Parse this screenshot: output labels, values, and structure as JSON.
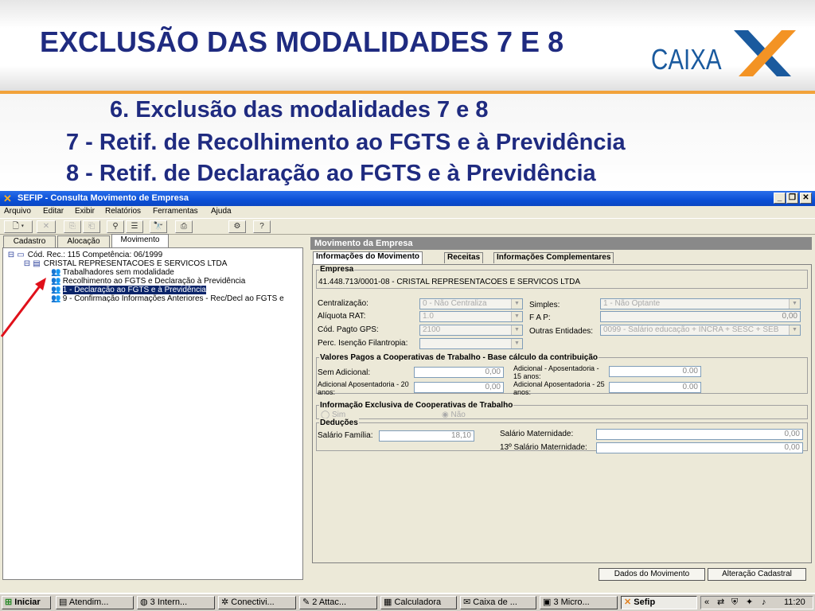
{
  "slide": {
    "title": "EXCLUSÃO DAS MODALIDADES 7 E 8",
    "logo_text": "CAIXA",
    "line1": "6. Exclusão das modalidades 7 e 8",
    "line2": "7 - Retif. de Recolhimento ao FGTS e à Previdência",
    "line3": "8 - Retif. de Declaração ao FGTS e à Previdência"
  },
  "window": {
    "title": "SEFIP - Consulta Movimento de Empresa",
    "menu": [
      "Arquivo",
      "Editar",
      "Exibir",
      "Relatórios",
      "Ferramentas",
      "Ajuda"
    ],
    "left_tabs": [
      "Cadastro",
      "Alocação",
      "Movimento"
    ],
    "tree": [
      "Cód. Rec.: 115 Competência: 06/1999",
      "CRISTAL REPRESENTACOES E SERVICOS LTDA",
      "Trabalhadores sem modalidade",
      "Recolhimento ao FGTS e Declaração à Previdência",
      "1 - Declaração ao FGTS e à Previdência",
      "9 - Confirmação Informações Anteriores - Rec/Decl ao FGTS e"
    ],
    "pane_title": "Movimento da Empresa",
    "right_tabs": [
      "Informações do Movimento",
      "Receitas",
      "Informações Complementares"
    ],
    "empresa_group": "Empresa",
    "empresa_value": "41.448.713/0001-08 - CRISTAL REPRESENTACOES E SERVICOS LTDA",
    "centralizacao_label": "Centralização:",
    "centralizacao_value": "0 - Não Centraliza",
    "simples_label": "Simples:",
    "simples_value": "1 - Não Optante",
    "rat_label": "Alíquota RAT:",
    "rat_value": "1.0",
    "fap_label": "F A P:",
    "fap_value": "0,00",
    "gps_label": "Cód. Pagto GPS:",
    "gps_value": "2100",
    "outras_label": "Outras Entidades:",
    "outras_value": "0099 - Salário educação + INCRA + SESC + SEB",
    "filantropia_label": "Perc. Isenção Filantropia:",
    "coop_group": "Valores Pagos a Cooperativas de Trabalho - Base cálculo da contribuição",
    "sem_adicional_label": "Sem Adicional:",
    "sem_adicional_value": "0,00",
    "ap15_label": "Adicional - Aposentadoria - 15 anos:",
    "ap15_value": "0.00",
    "ap20_label": "Adicional Aposentadoria - 20 anos:",
    "ap20_value": "0,00",
    "ap25_label": "Adicional Aposentadoria - 25 anos:",
    "ap25_value": "0.00",
    "excl_group": "Informação Exclusiva de Cooperativas de Trabalho",
    "sim": "Sim",
    "nao": "Não",
    "deducoes_group": "Deduções",
    "salfam_label": "Salário Família:",
    "salfam_value": "18,10",
    "salmat_label": "Salário Maternidade:",
    "salmat_value": "0,00",
    "salmat13_label": "13º Salário Maternidade:",
    "salmat13_value": "0,00",
    "btn_dados": "Dados do Movimento",
    "btn_alteracao": "Alteração Cadastral"
  },
  "taskbar": {
    "start": "Iniciar",
    "items": [
      "Atendim...",
      "3 Intern...",
      "Conectivi...",
      "2 Attac...",
      "Calculadora",
      "Caixa de ...",
      "3 Micro...",
      "Sefip"
    ],
    "clock": "11:20"
  }
}
